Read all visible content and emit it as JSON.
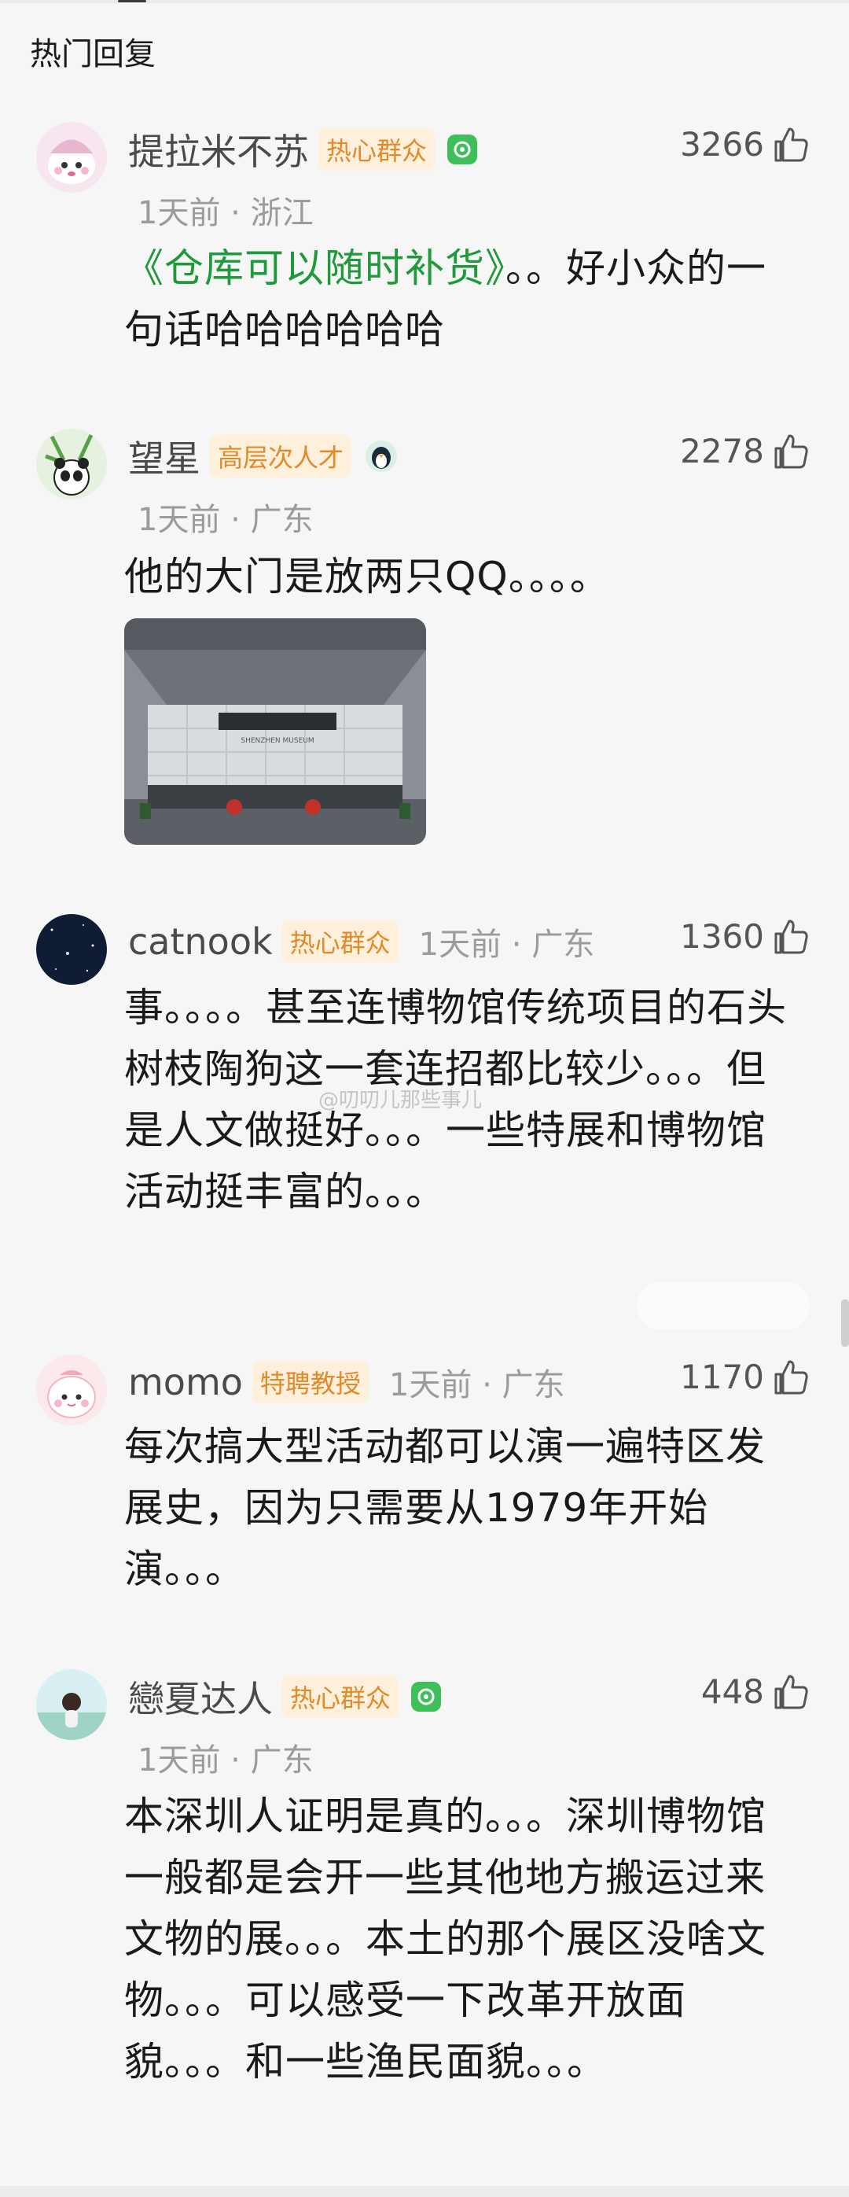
{
  "section_title": "热门回复",
  "watermark": "@叨叨儿那些事儿",
  "comments": [
    {
      "username": "提拉米不苏",
      "badge": "热心群众",
      "likes": "3266",
      "meta": "1天前 · 浙江",
      "quote": "《仓库可以随时补货》",
      "text_rest": "。。好小众的一句话哈哈哈哈哈哈",
      "icon": "green-v-icon"
    },
    {
      "username": "望星",
      "badge": "高层次人才",
      "likes": "2278",
      "meta": "1天前 · 广东",
      "text": "他的大门是放两只QQ。。。。",
      "image_alt": "Shenzhen Museum entrance photo",
      "museum_sign": "SHENZHEN MUSEUM",
      "icon": "penguin-badge-icon"
    },
    {
      "username": "catnook",
      "badge": "热心群众",
      "likes": "1360",
      "meta": "1天前 · 广东",
      "text": "事。。。。甚至连博物馆传统项目的石头树枝陶狗这一套连招都比较少。。。但是人文做挺好。。。一些特展和博物馆活动挺丰富的。。。"
    },
    {
      "username": "momo",
      "badge": "特聘教授",
      "likes": "1170",
      "meta": "1天前 · 广东",
      "text": "每次搞大型活动都可以演一遍特区发展史，因为只需要从1979年开始演。。。"
    },
    {
      "username": "戀夏达人",
      "badge": "热心群众",
      "likes": "448",
      "meta": "1天前 · 广东",
      "text": "本深圳人证明是真的。。。深圳博物馆一般都是会开一些其他地方搬运过来文物的展。。。本土的那个展区没啥文物。。。可以感受一下改革开放面貌。。。和一些渔民面貌。。。",
      "icon": "green-v-icon"
    }
  ],
  "colors": {
    "badge_text": "#e08a2a",
    "badge_bg": "#fff0dc",
    "quote_green": "#1f9a3a",
    "v_green": "#3fbf5a"
  }
}
